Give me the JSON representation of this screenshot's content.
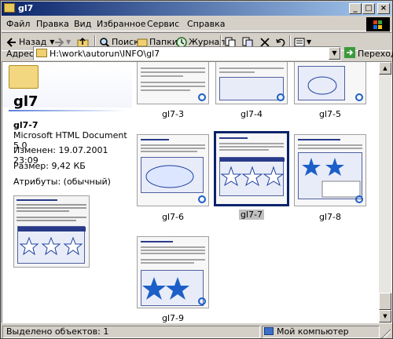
{
  "window": {
    "title": "gl7"
  },
  "menu": [
    "Файл",
    "Правка",
    "Вид",
    "Избранное",
    "Сервис",
    "Справка"
  ],
  "toolbar": {
    "back_label": "Назад",
    "search_label": "Поиск",
    "folders_label": "Папки",
    "history_label": "Журнал"
  },
  "address": {
    "label": "Адрес",
    "value": "H:\\work\\autorun\\INFO\\gl7",
    "go_label": "Переход"
  },
  "details": {
    "folder_title": "gl7",
    "file_name": "gl7-7",
    "file_type": "Microsoft HTML Document 5.0",
    "modified": "Изменен: 19.07.2001 23:09",
    "size": "Размер: 9,42 КБ",
    "attributes": "Атрибуты: (обычный)"
  },
  "thumbnails": [
    {
      "label": "gl7-3",
      "selected": false
    },
    {
      "label": "gl7-4",
      "selected": false
    },
    {
      "label": "gl7-5",
      "selected": false
    },
    {
      "label": "gl7-6",
      "selected": false
    },
    {
      "label": "gl7-7",
      "selected": true
    },
    {
      "label": "gl7-8",
      "selected": false
    },
    {
      "label": "gl7-9",
      "selected": false
    }
  ],
  "status": {
    "selected_text": "Выделено объектов: 1",
    "location_text": "Мой компьютер"
  }
}
